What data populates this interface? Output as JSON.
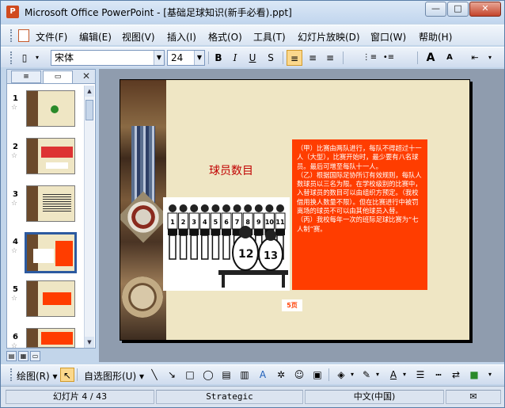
{
  "window": {
    "title": "Microsoft Office PowerPoint - [基础足球知识(新手必看).ppt]",
    "app_icon": "powerpoint-icon",
    "controls": {
      "minimize": "—",
      "maximize": "□",
      "close": "✕"
    }
  },
  "menubar": {
    "items": [
      "文件(F)",
      "编辑(E)",
      "视图(V)",
      "插入(I)",
      "格式(O)",
      "工具(T)",
      "幻灯片放映(D)",
      "窗口(W)",
      "帮助(H)"
    ]
  },
  "formatting_toolbar": {
    "font_name": "宋体",
    "font_size": "24",
    "bold": "B",
    "italic": "I",
    "underline": "U",
    "shadow": "S",
    "align_left": "≡",
    "align_center": "≡",
    "align_right": "≡",
    "numbering": "⋮≡",
    "bullets": "•≡",
    "grow_font": "A",
    "shrink_font": "A"
  },
  "slide_pane": {
    "tab_outline": "≡",
    "tab_slides": "▭",
    "close": "✕",
    "slides": [
      {
        "number": "1",
        "selected": false
      },
      {
        "number": "2",
        "selected": false
      },
      {
        "number": "3",
        "selected": false
      },
      {
        "number": "4",
        "selected": true
      },
      {
        "number": "5",
        "selected": false
      },
      {
        "number": "6",
        "selected": false
      }
    ],
    "star": "☆"
  },
  "slide": {
    "title": "球员数目",
    "rules_text": [
      "（甲）比赛由两队进行，每队不得超过十一人（大型），比赛开始时，最少要有八名球员。最后可增至每队十一人。",
      "（乙）根据国际足协所订有效规则，每队人数球员以三名为限。在学校级别的比赛中，入替球员的数目可以由组织方预定。（我校借用换人数量不限）。但在比赛进行中被罚离场的球员不可以由其他球员入替。",
      "（丙）我校每年一次的班际足球比赛为“七人制”赛。"
    ],
    "page_label": "5页",
    "jersey_numbers": [
      "1",
      "2",
      "3",
      "4",
      "5",
      "6",
      "7",
      "8",
      "9",
      "10",
      "11",
      "12",
      "13"
    ]
  },
  "drawing_toolbar": {
    "draw_menu": "绘图(R)",
    "autoshapes_menu": "自选图形(U)"
  },
  "statusbar": {
    "slide_position": "幻灯片 4 / 43",
    "design_template": "Strategic",
    "language": "中文(中国)"
  }
}
